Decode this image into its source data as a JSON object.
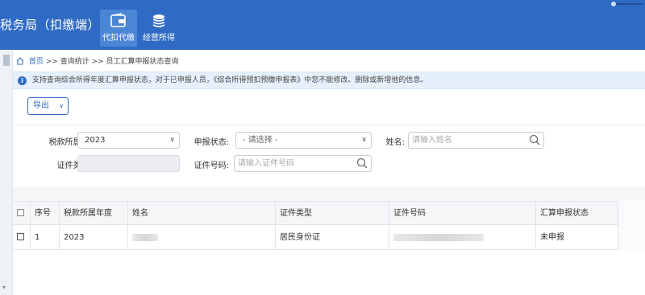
{
  "header": {
    "title": "税务局（扣缴端）",
    "nav": [
      {
        "label": "代扣代缴",
        "icon": "wallet-icon",
        "active": true
      },
      {
        "label": "经营所得",
        "icon": "coins-icon",
        "active": false
      }
    ]
  },
  "breadcrumb": {
    "home": "首页",
    "path": ">> 查询统计 >> 员工汇算申报状态查询"
  },
  "notice": {
    "text": "支持查询综合所得年度汇算申报状态，对于已申报人员，《综合所得预扣预缴申报表》中您不能修改、删除或新增他的信息。"
  },
  "toolbar": {
    "export_label": "导出"
  },
  "filters": {
    "period_label": "税款所属期:",
    "period_value": "2023",
    "status_label": "申报状态:",
    "status_value": "- 请选择 -",
    "name_label": "姓名:",
    "name_placeholder": "请输入姓名",
    "id_type_label": "证件类型:",
    "id_number_label": "证件号码:",
    "id_number_placeholder": "请输入证件号码"
  },
  "table": {
    "columns": [
      "序号",
      "税款所属年度",
      "姓名",
      "证件类型",
      "证件号码",
      "汇算申报状态"
    ],
    "rows": [
      {
        "index": "1",
        "year": "2023",
        "name": "",
        "id_type": "居民身份证",
        "id_number": "",
        "status": "未申报"
      }
    ]
  },
  "colors": {
    "header_bg": "#2f6bc4",
    "accent": "#2f6bc4",
    "notice_bg": "#e6f0fb"
  }
}
